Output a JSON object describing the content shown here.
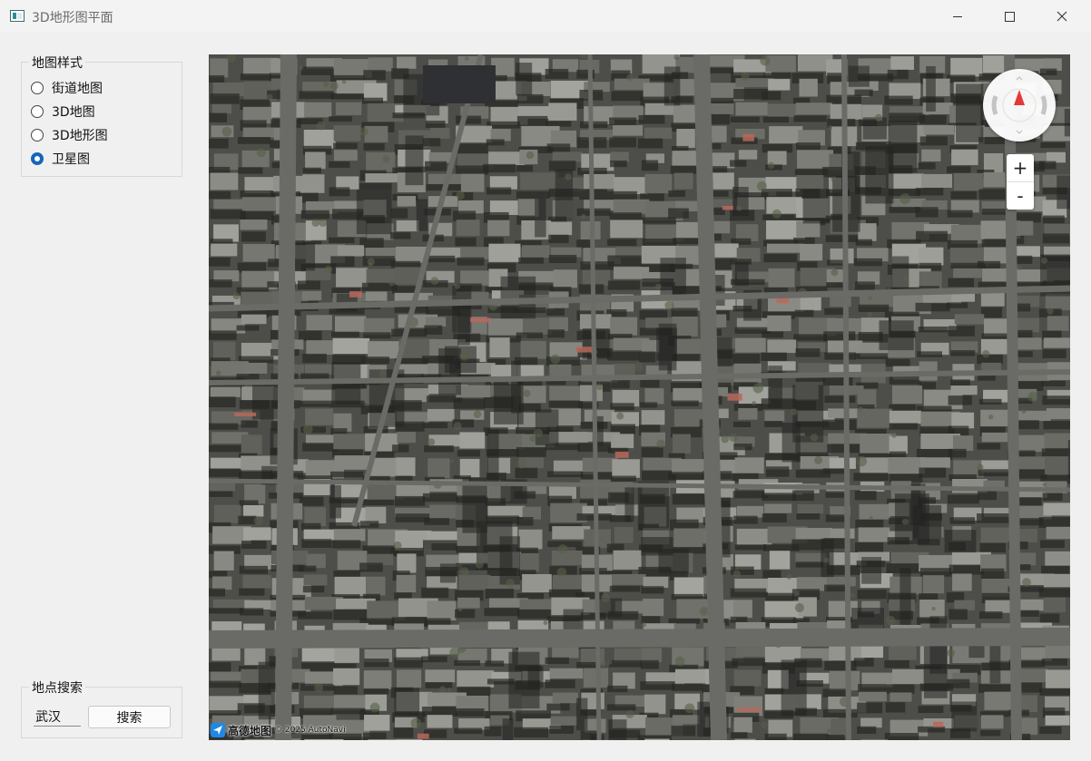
{
  "window": {
    "title": "3D地形图平面"
  },
  "map_style": {
    "title": "地图样式",
    "options": [
      {
        "label": "街道地图",
        "checked": false
      },
      {
        "label": "3D地图",
        "checked": false
      },
      {
        "label": "3D地形图",
        "checked": false
      },
      {
        "label": "卫星图",
        "checked": true
      }
    ]
  },
  "place_search": {
    "title": "地点搜索",
    "input_value": "武汉",
    "button_label": "搜索"
  },
  "map": {
    "zoom_in_label": "+",
    "zoom_out_label": "-",
    "logo_name": "高德地图",
    "copyright": "© 2025 AutoNavi",
    "compass_needle_color": "#e53935"
  }
}
